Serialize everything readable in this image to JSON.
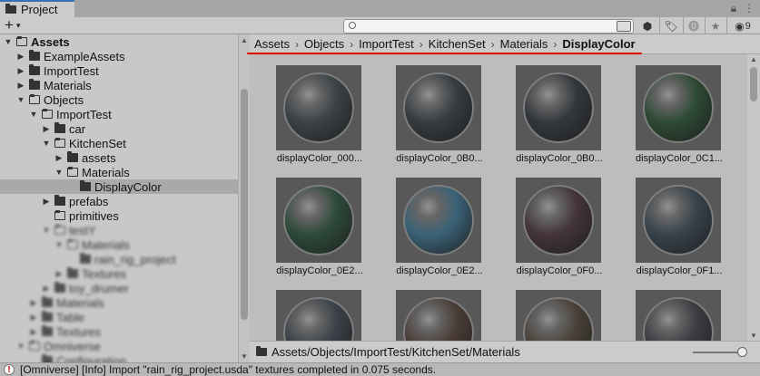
{
  "window": {
    "tab_label": "Project",
    "hidden_count": "9"
  },
  "toolbar": {
    "add_label": "+",
    "search_placeholder": ""
  },
  "tree": {
    "items": [
      {
        "label": "Assets",
        "indent": 0,
        "arrow": "open",
        "folder": "open",
        "bold": true
      },
      {
        "label": "ExampleAssets",
        "indent": 1,
        "arrow": "closed",
        "folder": "closed"
      },
      {
        "label": "ImportTest",
        "indent": 1,
        "arrow": "closed",
        "folder": "closed"
      },
      {
        "label": "Materials",
        "indent": 1,
        "arrow": "closed",
        "folder": "closed"
      },
      {
        "label": "Objects",
        "indent": 1,
        "arrow": "open",
        "folder": "open"
      },
      {
        "label": "ImportTest",
        "indent": 2,
        "arrow": "open",
        "folder": "open"
      },
      {
        "label": "car",
        "indent": 3,
        "arrow": "closed",
        "folder": "closed"
      },
      {
        "label": "KitchenSet",
        "indent": 3,
        "arrow": "open",
        "folder": "open"
      },
      {
        "label": "assets",
        "indent": 4,
        "arrow": "closed",
        "folder": "closed"
      },
      {
        "label": "Materials",
        "indent": 4,
        "arrow": "open",
        "folder": "open"
      },
      {
        "label": "DisplayColor",
        "indent": 5,
        "arrow": "none",
        "folder": "closed",
        "selected": true
      },
      {
        "label": "prefabs",
        "indent": 3,
        "arrow": "closed",
        "folder": "closed"
      },
      {
        "label": "primitives",
        "indent": 3,
        "arrow": "none",
        "folder": "empty"
      },
      {
        "label": "testY",
        "indent": 3,
        "arrow": "open",
        "folder": "open",
        "blur": true
      },
      {
        "label": "Materials",
        "indent": 4,
        "arrow": "open",
        "folder": "open",
        "blur": true
      },
      {
        "label": "rain_rig_project",
        "indent": 5,
        "arrow": "none",
        "folder": "closed",
        "blur": true
      },
      {
        "label": "Textures",
        "indent": 4,
        "arrow": "closed",
        "folder": "closed",
        "blur": true
      },
      {
        "label": "toy_drumer",
        "indent": 3,
        "arrow": "closed",
        "folder": "closed",
        "blur": true
      },
      {
        "label": "Materials",
        "indent": 2,
        "arrow": "closed",
        "folder": "closed",
        "blur": true
      },
      {
        "label": "Table",
        "indent": 2,
        "arrow": "closed",
        "folder": "closed",
        "blur": true
      },
      {
        "label": "Textures",
        "indent": 2,
        "arrow": "closed",
        "folder": "closed",
        "blur": true
      },
      {
        "label": "Omniverse",
        "indent": 1,
        "arrow": "open",
        "folder": "open",
        "blur": true
      },
      {
        "label": "Configuration",
        "indent": 2,
        "arrow": "none",
        "folder": "closed",
        "blur": true
      }
    ]
  },
  "breadcrumb": [
    "Assets",
    "Objects",
    "ImportTest",
    "KitchenSet",
    "Materials",
    "DisplayColor"
  ],
  "assets": [
    {
      "label": "displayColor_000...",
      "color": "#3b4246"
    },
    {
      "label": "displayColor_0B0...",
      "color": "#353b40"
    },
    {
      "label": "displayColor_0B0...",
      "color": "#33373c"
    },
    {
      "label": "displayColor_0C1...",
      "color": "#2c4a34"
    },
    {
      "label": "displayColor_0E2...",
      "color": "#2c4a3a"
    },
    {
      "label": "displayColor_0E2...",
      "color": "#3a6277"
    },
    {
      "label": "displayColor_0F0...",
      "color": "#433439"
    },
    {
      "label": "displayColor_0F1...",
      "color": "#37434d"
    },
    {
      "label": "",
      "color": "#3a4148"
    },
    {
      "label": "",
      "color": "#4a3c36"
    },
    {
      "label": "",
      "color": "#4a4138"
    },
    {
      "label": "",
      "color": "#3b3d42"
    }
  ],
  "path_bar": {
    "path": "Assets/Objects/ImportTest/KitchenSet/Materials"
  },
  "status": {
    "message": "[Omniverse] [Info] Import \"rain_rig_project.usda\" textures completed in 0.075 seconds."
  },
  "colors": {
    "tab_accent": "#3a72b0",
    "annotation_underline": "#e00000"
  }
}
